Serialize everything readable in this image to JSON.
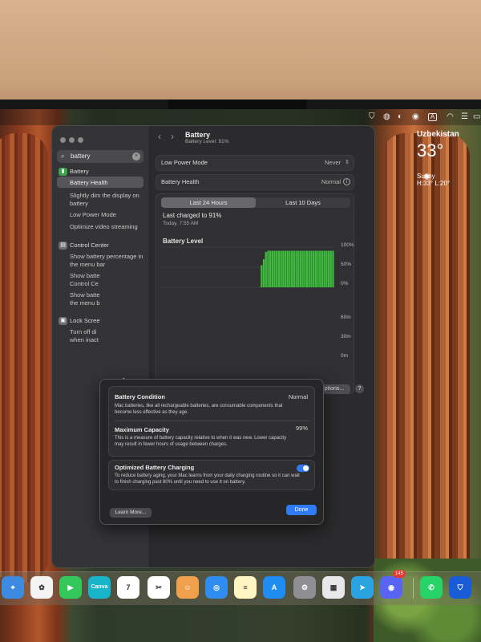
{
  "weather": {
    "city": "Uzbekistan",
    "temperature": "33°",
    "condition": "Sunny",
    "high_low": "H:33° L:20°"
  },
  "sidebar": {
    "search_value": "battery",
    "items": [
      {
        "label": "Battery",
        "type": "header",
        "icon": "battery-icon"
      },
      {
        "label": "Battery Health",
        "selected": true
      },
      {
        "label": "Slightly dim the display on battery"
      },
      {
        "label": "Low Power Mode"
      },
      {
        "label": "Optimize video streaming"
      },
      {
        "label": "Control Center",
        "type": "header",
        "icon": "control-center-icon"
      },
      {
        "label": "Show battery percentage in the menu bar"
      },
      {
        "label": "Show batte Control Ce"
      },
      {
        "label": "Show batte the menu b"
      },
      {
        "label": "Lock Scree",
        "type": "header",
        "icon": "lock-icon"
      },
      {
        "label": "Turn off di when inact"
      }
    ]
  },
  "header": {
    "title": "Battery",
    "subtitle": "Battery Level: 91%"
  },
  "settings_rows": [
    {
      "label": "Low Power Mode",
      "value": "Never"
    },
    {
      "label": "Battery Health",
      "value": "Normal"
    }
  ],
  "usage": {
    "tabs": [
      "Last 24 Hours",
      "Last 10 Days"
    ],
    "active_tab": 0,
    "last_charged": "Last charged to 91%",
    "last_charged_date": "Today, 7:55 AM",
    "battery_level_label": "Battery Level",
    "y_labels_level": [
      "100%",
      "50%",
      "0%"
    ],
    "y_labels_screen": [
      "60m",
      "30m",
      "0m"
    ],
    "options_label": "ptions...",
    "help_label": "?"
  },
  "chart_data": {
    "type": "bar",
    "title": "Battery Level",
    "ylim": [
      0,
      100
    ],
    "y_ticks": [
      "100%",
      "50%",
      "0%"
    ],
    "values": [
      0,
      0,
      0,
      0,
      0,
      0,
      0,
      0,
      0,
      0,
      0,
      0,
      0,
      0,
      0,
      0,
      0,
      0,
      0,
      0,
      0,
      0,
      0,
      0,
      0,
      0,
      0,
      0,
      0,
      0,
      0,
      0,
      0,
      0,
      0,
      0,
      0,
      0,
      0,
      0,
      0,
      0,
      0,
      0,
      0,
      0,
      55,
      70,
      88,
      91,
      91,
      91,
      91,
      91,
      91,
      91,
      91,
      91,
      91,
      91,
      91,
      91,
      91,
      91,
      91,
      91,
      91,
      91,
      91,
      91,
      91,
      91,
      91,
      91,
      91,
      91,
      91,
      91,
      91,
      91
    ],
    "color": "#3dbb3d"
  },
  "popover": {
    "condition_title": "Battery Condition",
    "condition_value": "Normal",
    "condition_desc": "Mac batteries, like all rechargeable batteries, are consumable components that become less effective as they age.",
    "capacity_title": "Maximum Capacity",
    "capacity_value": "99%",
    "capacity_desc": "This is a measure of battery capacity relative to when it was new. Lower capacity may result in fewer hours of usage between charges.",
    "optimized_title": "Optimized Battery Charging",
    "optimized_enabled": true,
    "optimized_desc": "To reduce battery aging, your Mac learns from your daily charging routine so it can wait to finish charging past 80% until you need to use it on battery.",
    "learn_more": "Learn More...",
    "done": "Done"
  },
  "dock": {
    "apps": [
      {
        "name": "Maps",
        "color": "#3d8be0",
        "glyph": "⌖"
      },
      {
        "name": "Photos",
        "color": "#f3f3f3",
        "glyph": "✿"
      },
      {
        "name": "FaceTime",
        "color": "#34c759",
        "glyph": "▶"
      },
      {
        "name": "Canva",
        "color": "#18b4c9",
        "glyph": "Canva"
      },
      {
        "name": "Calendar",
        "color": "#ffffff",
        "glyph": "7",
        "month": "JUN"
      },
      {
        "name": "CapCut",
        "color": "#ffffff",
        "glyph": "✂"
      },
      {
        "name": "Contacts",
        "color": "#f0a04b",
        "glyph": "☺"
      },
      {
        "name": "Safari",
        "color": "#2f8cf0",
        "glyph": "◎"
      },
      {
        "name": "Notes",
        "color": "#fff4c2",
        "glyph": "≡"
      },
      {
        "name": "App Store",
        "color": "#1e8cf0",
        "glyph": "A"
      },
      {
        "name": "System Settings",
        "color": "#8e8e93",
        "glyph": "⚙"
      },
      {
        "name": "Preview",
        "color": "#e8e8ec",
        "glyph": "▦"
      },
      {
        "name": "Telegram",
        "color": "#2aa3e0",
        "glyph": "➤"
      },
      {
        "name": "Discord",
        "color": "#5865f2",
        "glyph": "◉"
      },
      {
        "name": "WhatsApp",
        "color": "#25d366",
        "glyph": "✆"
      },
      {
        "name": "VPN",
        "color": "#1a5bd8",
        "glyph": "⛉"
      }
    ],
    "discord_badge": "145"
  }
}
